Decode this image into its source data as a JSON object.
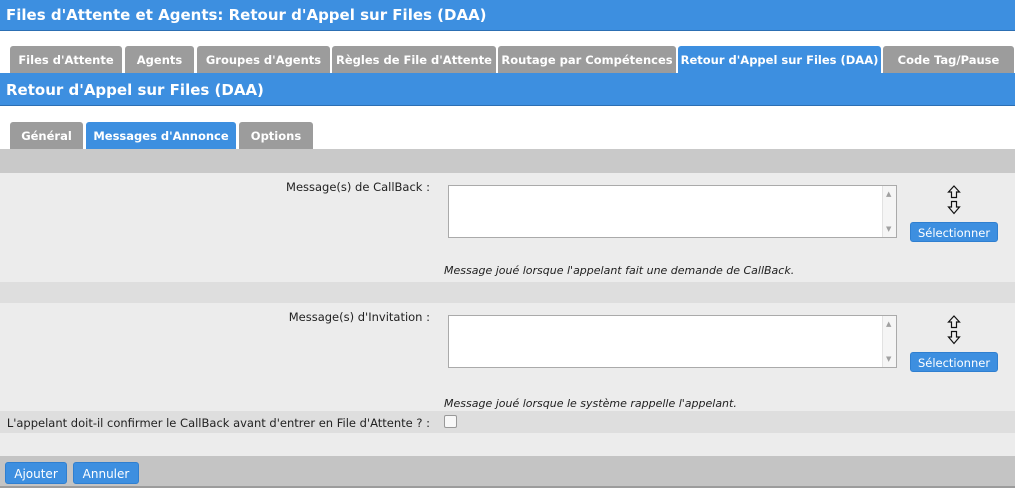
{
  "header": {
    "title": "Files d'Attente et Agents:  Retour d'Appel sur Files (DAA)"
  },
  "main_tabs": [
    {
      "label": "Files d'Attente",
      "active": false
    },
    {
      "label": "Agents",
      "active": false
    },
    {
      "label": "Groupes d'Agents",
      "active": false
    },
    {
      "label": "Règles de File d'Attente",
      "active": false
    },
    {
      "label": "Routage par Compétences",
      "active": false
    },
    {
      "label": "Retour d'Appel sur Files (DAA)",
      "active": true
    },
    {
      "label": "Code Tag/Pause",
      "active": false
    }
  ],
  "section": {
    "title": "Retour d'Appel sur Files (DAA)"
  },
  "sub_tabs": [
    {
      "label": "Général",
      "active": false
    },
    {
      "label": "Messages d'Annonce",
      "active": true
    },
    {
      "label": "Options",
      "active": false
    }
  ],
  "form": {
    "callback": {
      "label": "Message(s) de CallBack  :",
      "value": "",
      "select_label": "Sélectionner",
      "hint": "Message joué lorsque l'appelant fait une demande de CallBack."
    },
    "invitation": {
      "label": "Message(s) d'Invitation  :",
      "value": "",
      "select_label": "Sélectionner",
      "hint": "Message joué lorsque le système rappelle l'appelant."
    },
    "confirm": {
      "label": "L'appelant doit-il confirmer le CallBack avant d'entrer en File d'Attente ?  :",
      "checked": false
    }
  },
  "footer": {
    "add_label": "Ajouter",
    "cancel_label": "Annuler"
  },
  "colors": {
    "accent": "#3d8fe0",
    "tab_inactive": "#9c9c9c",
    "band_dark": "#c9c9c9",
    "band_light": "#ececec"
  }
}
